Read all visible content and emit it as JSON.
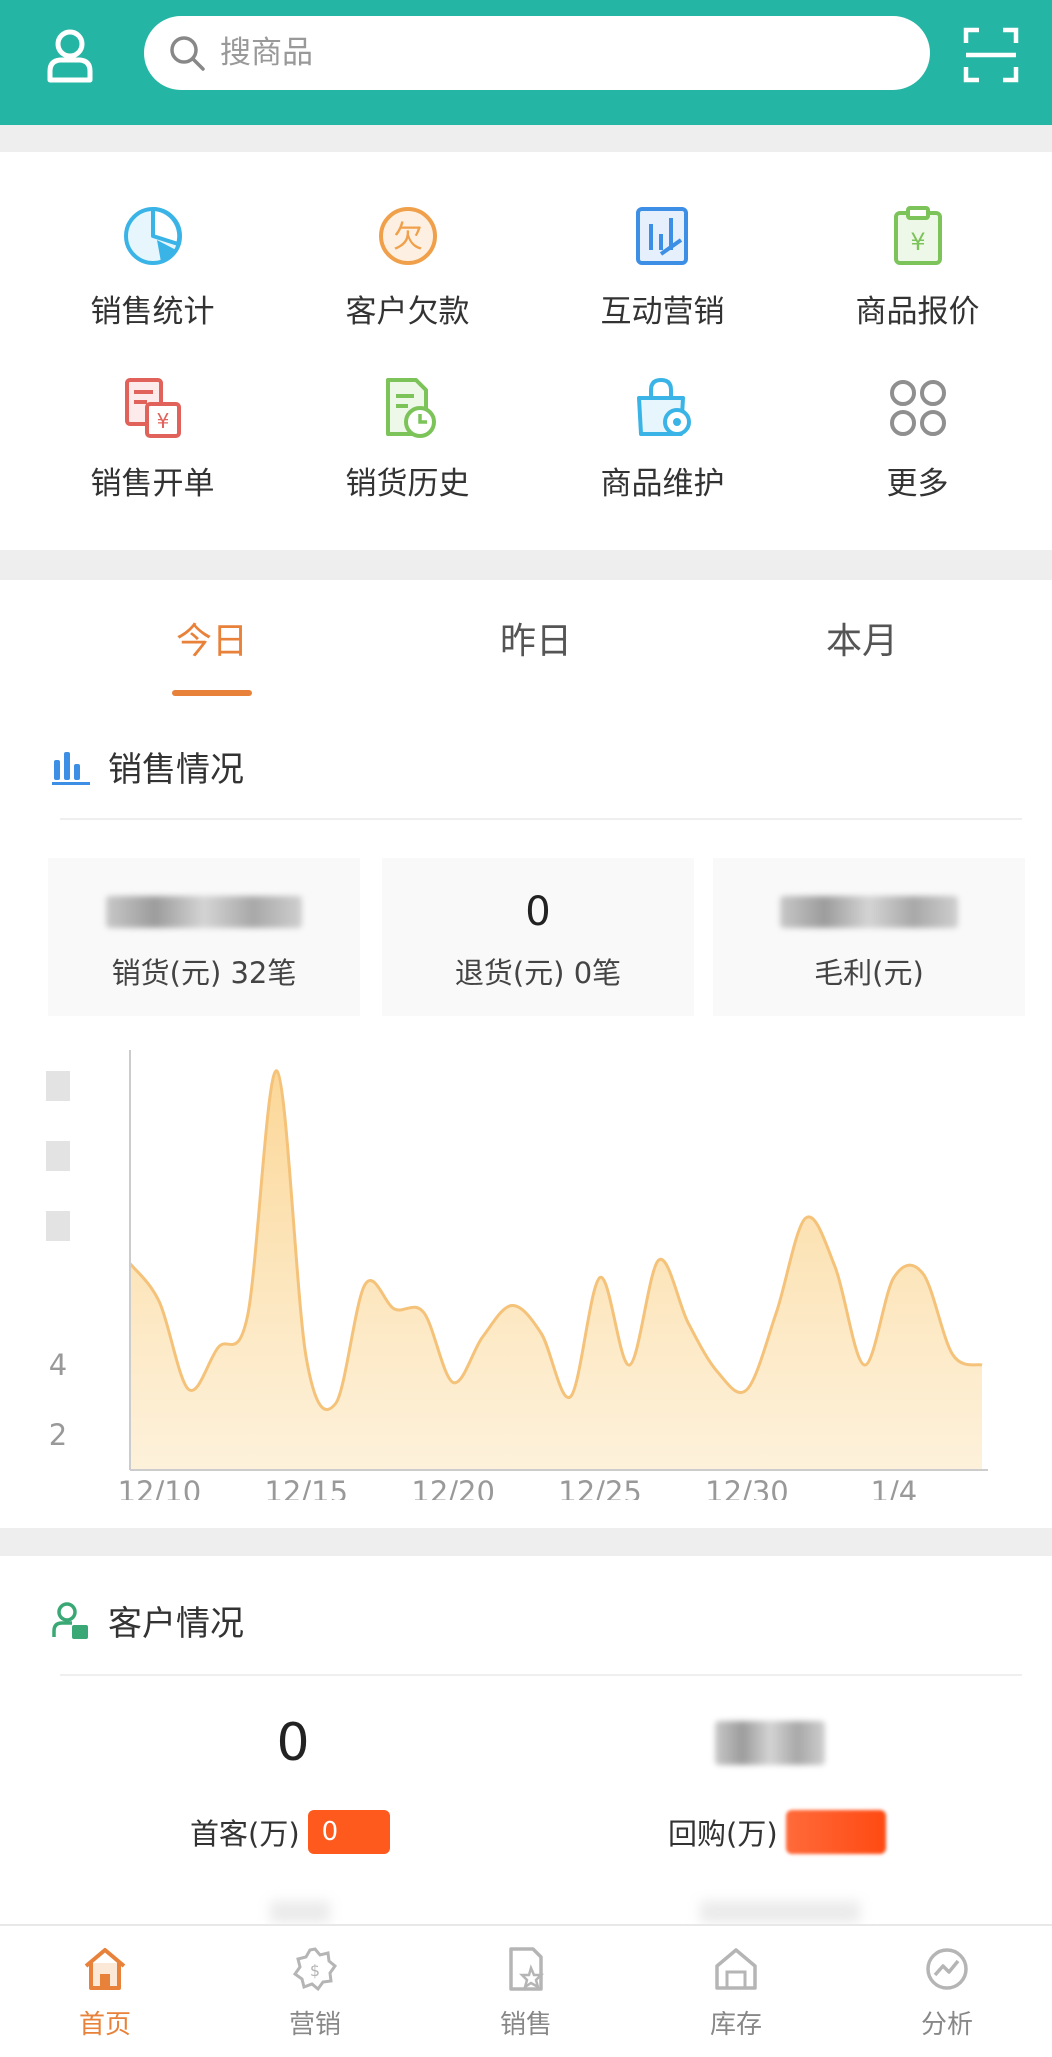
{
  "header": {
    "search_placeholder": "搜商品",
    "user_icon": "user-icon",
    "scan_icon": "scan-icon",
    "theme_color": "#25b5a4"
  },
  "menu": {
    "items": [
      {
        "label": "销售统计",
        "icon": "pie-chart-icon",
        "color": "#3ab4e6"
      },
      {
        "label": "客户欠款",
        "icon": "debt-icon",
        "color": "#f0a04b"
      },
      {
        "label": "互动营销",
        "icon": "marketing-icon",
        "color": "#3d8fe6"
      },
      {
        "label": "商品报价",
        "icon": "price-clipboard-icon",
        "color": "#7cc35a"
      },
      {
        "label": "销售开单",
        "icon": "bill-icon",
        "color": "#e0625a"
      },
      {
        "label": "销货历史",
        "icon": "history-icon",
        "color": "#7cc35a"
      },
      {
        "label": "商品维护",
        "icon": "goods-settings-icon",
        "color": "#3ab4e6"
      },
      {
        "label": "更多",
        "icon": "more-grid-icon",
        "color": "#8f8f8f"
      }
    ]
  },
  "tabs": {
    "items": [
      "今日",
      "昨日",
      "本月"
    ],
    "active_index": 0,
    "active_color": "#e8823a"
  },
  "sales": {
    "title": "销售情况",
    "stats": [
      {
        "value": "",
        "label": "销货(元) 32笔"
      },
      {
        "value": "0",
        "label": "退货(元) 0笔"
      },
      {
        "value": "",
        "label": "毛利(元)"
      }
    ]
  },
  "chart_data": {
    "type": "area",
    "x": [
      "12/9",
      "12/10",
      "12/11",
      "12/12",
      "12/13",
      "12/14",
      "12/15",
      "12/16",
      "12/17",
      "12/18",
      "12/19",
      "12/20",
      "12/21",
      "12/22",
      "12/23",
      "12/24",
      "12/25",
      "12/26",
      "12/27",
      "12/28",
      "12/29",
      "12/30",
      "12/31",
      "1/1",
      "1/2",
      "1/3",
      "1/4",
      "1/5",
      "1/6",
      "1/7"
    ],
    "y": [
      6.9,
      5.8,
      3.3,
      4.5,
      5.4,
      12.4,
      4.2,
      2.9,
      6.3,
      5.6,
      5.5,
      3.5,
      4.8,
      5.7,
      4.9,
      3.1,
      6.5,
      4.0,
      7.0,
      5.2,
      3.8,
      3.3,
      5.5,
      8.2,
      6.8,
      4.0,
      6.5,
      6.6,
      4.3,
      4.0
    ],
    "x_ticks": [
      "12/10",
      "12/15",
      "12/20",
      "12/25",
      "12/30",
      "1/4"
    ],
    "y_ticks": [
      "2",
      "4"
    ],
    "ylim": [
      1,
      13
    ],
    "grid": false,
    "fill_color": "#fbdca0",
    "line_color": "#f5c27a"
  },
  "customer": {
    "title": "客户情况",
    "first_value": "0",
    "first_label": "首客(万)",
    "first_badge": "0",
    "repeat_value": "",
    "repeat_label": "回购(万)",
    "repeat_badge": "",
    "title_icon_color": "#3aa874"
  },
  "bottom_nav": {
    "items": [
      {
        "label": "首页",
        "icon": "home-icon"
      },
      {
        "label": "营销",
        "icon": "marketing-badge-icon"
      },
      {
        "label": "销售",
        "icon": "sales-doc-icon"
      },
      {
        "label": "库存",
        "icon": "warehouse-icon"
      },
      {
        "label": "分析",
        "icon": "analysis-icon"
      }
    ],
    "active_index": 0,
    "active_color": "#e8823a"
  }
}
